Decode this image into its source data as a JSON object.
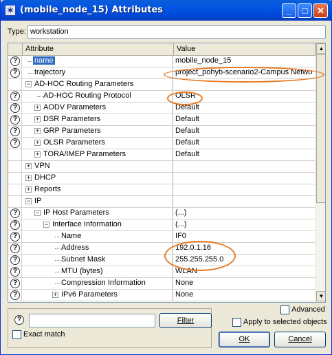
{
  "window": {
    "title": "(mobile_node_15) Attributes",
    "app_icon": "opnet-star-icon"
  },
  "type": {
    "label": "Type:",
    "value": "workstation"
  },
  "grid": {
    "col_attribute": "Attribute",
    "col_value": "Value",
    "rows": [
      {
        "help": true,
        "indent": 1,
        "expander": "",
        "label": "name",
        "value": "mobile_node_15",
        "selected": true
      },
      {
        "help": true,
        "indent": 1,
        "expander": "",
        "label": "trajectory",
        "value": "project_pohyb-scenario2-Campus Netwo..."
      },
      {
        "help": false,
        "indent": 1,
        "expander": "-",
        "label": "AD-HOC Routing Parameters",
        "value": ""
      },
      {
        "help": true,
        "indent": 2,
        "expander": "",
        "label": "AD-HOC Routing Protocol",
        "value": "OLSR"
      },
      {
        "help": true,
        "indent": 2,
        "expander": "+",
        "label": "AODV Parameters",
        "value": "Default"
      },
      {
        "help": true,
        "indent": 2,
        "expander": "+",
        "label": "DSR Parameters",
        "value": "Default"
      },
      {
        "help": true,
        "indent": 2,
        "expander": "+",
        "label": "GRP Parameters",
        "value": "Default"
      },
      {
        "help": true,
        "indent": 2,
        "expander": "+",
        "label": "OLSR Parameters",
        "value": "Default"
      },
      {
        "help": false,
        "indent": 2,
        "expander": "+",
        "label": "TORA/IMEP Parameters",
        "value": "Default"
      },
      {
        "help": false,
        "indent": 1,
        "expander": "+",
        "label": "VPN",
        "value": ""
      },
      {
        "help": false,
        "indent": 1,
        "expander": "+",
        "label": "DHCP",
        "value": ""
      },
      {
        "help": false,
        "indent": 1,
        "expander": "+",
        "label": "Reports",
        "value": ""
      },
      {
        "help": false,
        "indent": 1,
        "expander": "-",
        "label": "IP",
        "value": ""
      },
      {
        "help": true,
        "indent": 2,
        "expander": "-",
        "label": "IP Host Parameters",
        "value": "(...)"
      },
      {
        "help": true,
        "indent": 3,
        "expander": "-",
        "label": "Interface Information",
        "value": "(...)"
      },
      {
        "help": true,
        "indent": 4,
        "expander": "",
        "label": "Name",
        "value": "IF0"
      },
      {
        "help": true,
        "indent": 4,
        "expander": "",
        "label": "Address",
        "value": "192.0.1.16"
      },
      {
        "help": true,
        "indent": 4,
        "expander": "",
        "label": "Subnet Mask",
        "value": "255.255.255.0"
      },
      {
        "help": true,
        "indent": 4,
        "expander": "",
        "label": "MTU (bytes)",
        "value": "WLAN"
      },
      {
        "help": true,
        "indent": 4,
        "expander": "",
        "label": "Compression Information",
        "value": "None"
      },
      {
        "help": true,
        "indent": 4,
        "expander": "+",
        "label": "IPv6 Parameters",
        "value": "None"
      }
    ]
  },
  "filter": {
    "button": "Filter",
    "value": ""
  },
  "exact_match": {
    "label": "Exact match",
    "checked": false
  },
  "advanced": {
    "label": "Advanced",
    "checked": false
  },
  "apply_selected": {
    "label": "Apply to selected objects",
    "checked": false
  },
  "buttons": {
    "ok": "OK",
    "cancel": "Cancel"
  },
  "colors": {
    "highlight_oval": "#e67a25",
    "selection": "#316ac5",
    "titlebar": "#0353e5"
  }
}
